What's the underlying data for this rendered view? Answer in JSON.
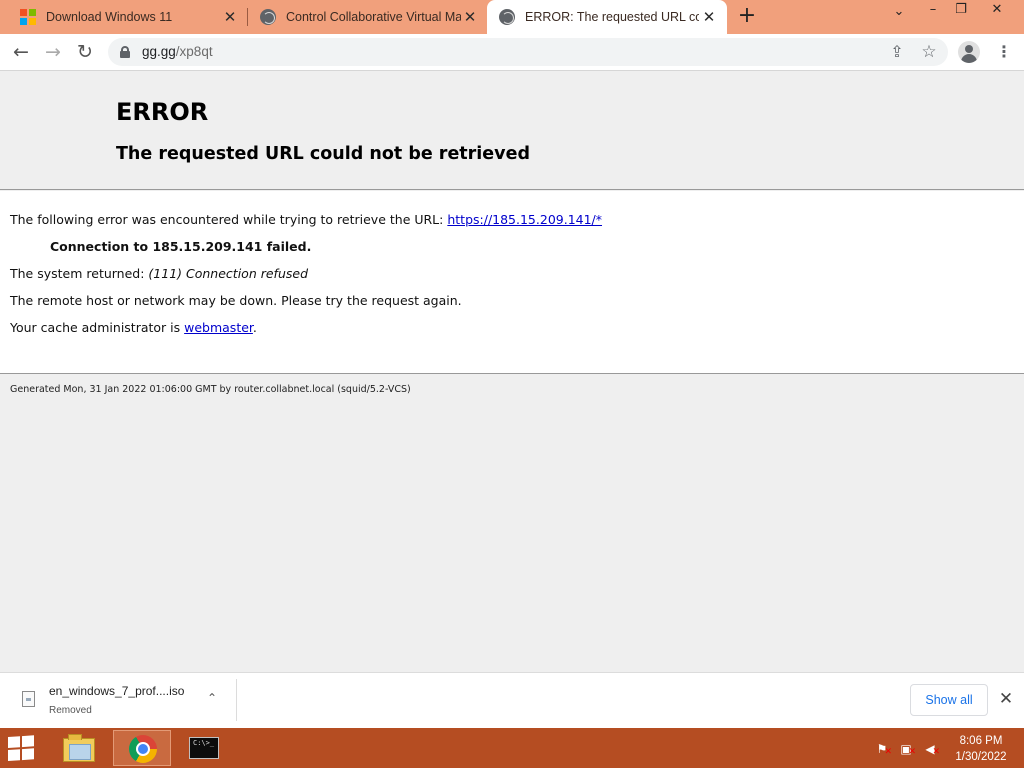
{
  "browser": {
    "tabs": [
      {
        "title": "Download Windows 11",
        "icon": "microsoft-logo-icon",
        "active": false
      },
      {
        "title": "Control Collaborative Virtual Ma",
        "icon": "globe-icon",
        "active": false
      },
      {
        "title": "ERROR: The requested URL could",
        "icon": "globe-icon",
        "active": true
      }
    ],
    "new_tab_icon": "+",
    "url": {
      "host": "gg.gg",
      "path": "/xp8qt"
    },
    "icons": {
      "back": "←",
      "forward": "→",
      "reload": "↻",
      "share": "⇪",
      "star": "☆",
      "menu": "⋮",
      "close": "✕",
      "dropdown": "⌄",
      "minimize": "–",
      "restore": "❐"
    }
  },
  "page": {
    "title": "ERROR",
    "subtitle": "The requested URL could not be retrieved",
    "error_intro": "The following error was encountered while trying to retrieve the URL: ",
    "error_url": "https://185.15.209.141/*",
    "connection_failed": "Connection to 185.15.209.141 failed.",
    "system_returned_label": "The system returned: ",
    "system_returned_value": "(111) Connection refused",
    "remote_down": "The remote host or network may be down. Please try the request again.",
    "cache_admin_label": "Your cache administrator is ",
    "cache_admin_link": "webmaster",
    "cache_admin_end": ".",
    "generated": "Generated Mon, 31 Jan 2022 01:06:00 GMT by router.collabnet.local (squid/5.2-VCS)"
  },
  "downloads": {
    "file_name": "en_windows_7_prof....iso",
    "status": "Removed",
    "chevron": "⌃",
    "show_all": "Show all",
    "close": "✕"
  },
  "taskbar": {
    "apps": [
      {
        "name": "File Explorer",
        "icon": "folder-icon"
      },
      {
        "name": "Google Chrome",
        "icon": "chrome-icon",
        "active": true
      },
      {
        "name": "Command Prompt",
        "icon": "cmd-icon"
      }
    ],
    "cmd_glyph": "C:\\>_",
    "time": "8:06 PM",
    "date": "1/30/2022"
  },
  "colors": {
    "tabbar": "#f1a07c",
    "taskbar": "#b54d22",
    "link": "#0000cc",
    "show_all_text": "#1a73e8"
  }
}
